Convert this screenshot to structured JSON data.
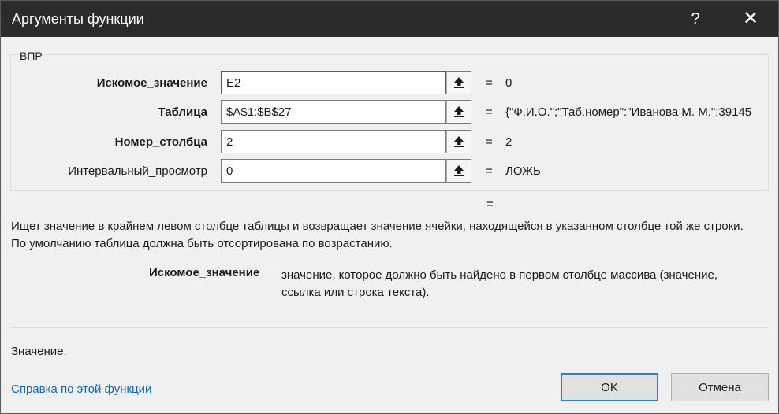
{
  "window": {
    "title": "Аргументы функции",
    "help_glyph": "?",
    "close_glyph": "✕"
  },
  "function_group": {
    "name": "ВПР",
    "args": [
      {
        "label": "Искомое_значение",
        "value": "E2",
        "result": "0",
        "bold": true
      },
      {
        "label": "Таблица",
        "value": "$A$1:$B$27",
        "result": "{\"Ф.И.О.\";\"Таб.номер\":\"Иванова М. М.\";39145",
        "bold": true
      },
      {
        "label": "Номер_столбца",
        "value": "2",
        "result": "2",
        "bold": true
      },
      {
        "label": "Интервальный_просмотр",
        "value": "0",
        "result": "ЛОЖЬ",
        "bold": false
      }
    ],
    "equals_sign": "="
  },
  "overall_equals": "=",
  "description": {
    "line1": "Ищет значение в крайнем левом столбце таблицы и возвращает значение ячейки, находящейся в указанном столбце той же строки.",
    "line2": "По умолчанию таблица должна быть отсортирована по возрастанию."
  },
  "param_help": {
    "name": "Искомое_значение",
    "text": "значение, которое должно быть найдено в первом столбце массива (значение, ссылка или строка текста)."
  },
  "value_label": "Значение:",
  "help_link": "Справка по этой функции",
  "buttons": {
    "ok": "OK",
    "cancel": "Отмена"
  },
  "icons": {
    "collapse": "collapse-dialog-arrow-icon"
  }
}
